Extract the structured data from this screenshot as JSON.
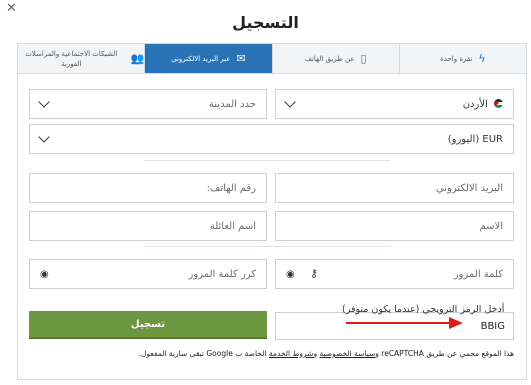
{
  "dialog": {
    "title": "التسجيل",
    "close_icon": "close-icon"
  },
  "tabs": [
    {
      "label": "نقرة واحدة",
      "icon": "lightning-icon",
      "active": false
    },
    {
      "label": "عن طريق الهاتف",
      "icon": "phone-icon",
      "active": false
    },
    {
      "label": "عبر البريد الالكتروني",
      "icon": "envelope-icon",
      "active": true
    },
    {
      "label": "الشبكات الاجتماعية والمراسلات الفورية",
      "icon": "users-icon",
      "active": false
    }
  ],
  "form": {
    "country": {
      "value": "الأردن",
      "icon": "jordan-flag-icon"
    },
    "city": {
      "placeholder": "حدد المدينة"
    },
    "currency": {
      "value": "EUR (اليورو)"
    },
    "email": {
      "placeholder": "البريد الالكتروني"
    },
    "phone": {
      "placeholder": "رقم الهاتف:"
    },
    "first_name": {
      "placeholder": "الاسم"
    },
    "last_name": {
      "placeholder": "اسم العائلة"
    },
    "password": {
      "placeholder": "كلمة المرور"
    },
    "confirm_password": {
      "placeholder": "كرر كلمة المرور"
    },
    "promo": {
      "label": "أدخل الرمز الترويجي (عندما يكون متوفر)",
      "value": "BBIG"
    },
    "submit_label": "تسجيل"
  },
  "legal": {
    "prefix": "هذا الموقع محمي عن طريق reCAPTCHA و",
    "privacy_link": "سياسة الخصوصية",
    "and": " و",
    "terms_link": "شروط الخدمة",
    "suffix": " الخاصة ب Google تبقى سارية المفعول."
  },
  "colors": {
    "accent": "#2a72b6",
    "submit": "#6d9640",
    "arrow": "#e21b1b"
  }
}
